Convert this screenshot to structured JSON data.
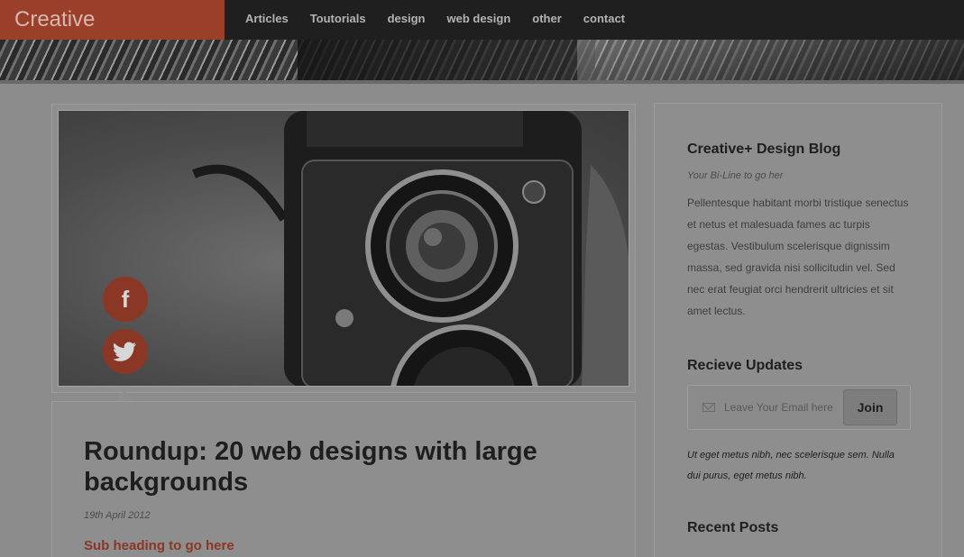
{
  "header": {
    "logo": "Creative",
    "nav": [
      "Articles",
      "Toutorials",
      "design",
      "web design",
      "other",
      "contact"
    ]
  },
  "hero": {
    "social": [
      {
        "icon": "facebook-icon",
        "glyph": "f"
      },
      {
        "icon": "twitter-icon",
        "glyph": "🐦"
      }
    ]
  },
  "post": {
    "title": "Roundup: 20 web designs with large backgrounds",
    "date": "19th April 2012",
    "subheading": "Sub heading to go here"
  },
  "sidebar": {
    "blog_title": "Creative+ Design Blog",
    "byline": "Your Bi-Line to go her",
    "body": "Pellentesque habitant morbi tristique senectus et netus et malesuada fames ac turpis egestas. Vestibulum scelerisque dignissim massa, sed gravida nisi sollicitudin vel. Sed nec erat feugiat orci hendrerit ultricies et sit amet lectus.",
    "updates_title": "Recieve Updates",
    "email_placeholder": "Leave Your Email here",
    "join_label": "Join",
    "note": "Ut eget metus nibh, nec scelerisque sem. Nulla dui purus, eget metus nibh.",
    "recent_title": "Recent Posts"
  },
  "colors": {
    "accent": "#8a3726",
    "logo_bg": "#9a3f2a",
    "topbar": "#1f1f1f"
  }
}
